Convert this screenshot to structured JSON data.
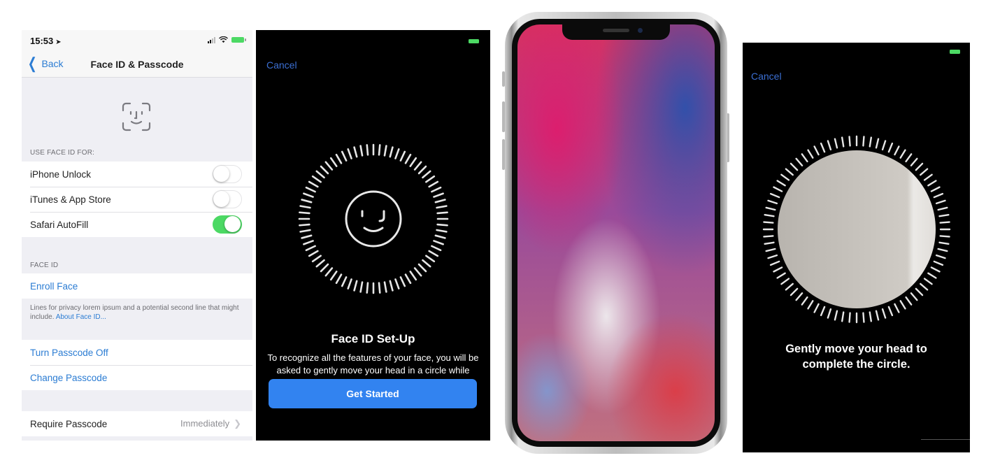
{
  "settings_screen": {
    "status_bar": {
      "time": "15:53",
      "location_icon": "location-arrow-icon",
      "icons": [
        "signal-icon",
        "wifi-icon",
        "battery-icon"
      ]
    },
    "nav": {
      "back_label": "Back",
      "title": "Face ID & Passcode"
    },
    "header_icon": "face-id-icon",
    "use_face_id_header": "USE FACE ID FOR:",
    "toggles": [
      {
        "label": "iPhone Unlock",
        "on": false
      },
      {
        "label": "iTunes & App Store",
        "on": false
      },
      {
        "label": "Safari AutoFill",
        "on": true
      }
    ],
    "face_id_header": "FACE ID",
    "enroll_label": "Enroll Face",
    "footnote_text": "Lines for privacy lorem ipsum and a potential second line that might include. ",
    "footnote_link": "About Face ID...",
    "passcode_actions": [
      "Turn Passcode Off",
      "Change Passcode"
    ],
    "require_passcode": {
      "label": "Require Passcode",
      "value": "Immediately"
    },
    "colors": {
      "accent": "#2b7cd3",
      "toggle_on": "#4cd964",
      "background": "#efeff4"
    }
  },
  "setup_screen": {
    "cancel_label": "Cancel",
    "icon": "face-smile-icon",
    "title": "Face ID Set-Up",
    "description": "To recognize all the features of your face, you will be asked to gently move your head in a circle while looking at the camera.",
    "button_label": "Get Started",
    "colors": {
      "button": "#3283f0",
      "cancel": "#3b6fd3"
    }
  },
  "device": {
    "name": "iPhone X",
    "wallpaper": "colorful-gradient"
  },
  "scan_screen": {
    "cancel_label": "Cancel",
    "message_line1": "Gently move your head to",
    "message_line2": "complete the circle.",
    "scan_progress": 0
  }
}
